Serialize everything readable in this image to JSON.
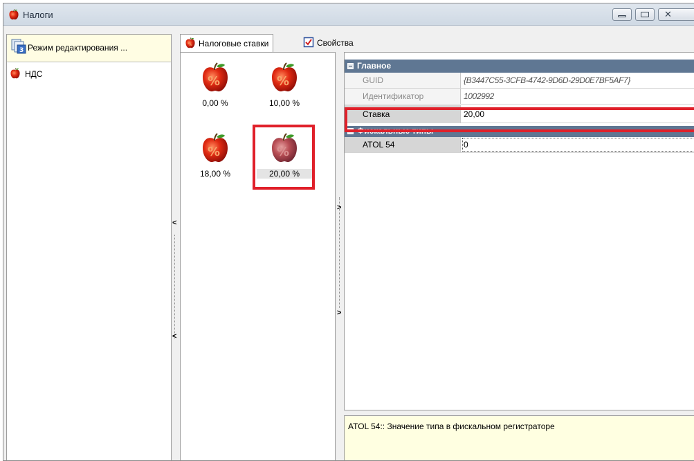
{
  "window": {
    "title": "Налоги",
    "controls": {
      "minimize": "minimize",
      "maximize": "maximize",
      "close": "close"
    }
  },
  "left_panel": {
    "mode_label": "Режим редактирования ...",
    "mode_icon": "edit-mode-icon",
    "tree": [
      {
        "label": "НДС",
        "icon": "apple-icon"
      }
    ]
  },
  "tabs": [
    {
      "label": "Налоговые ставки",
      "icon": "tax-apple-icon",
      "active": true
    },
    {
      "label": "Свойства",
      "icon": "checkbox-properties-icon",
      "active": false
    }
  ],
  "tax_rates": [
    {
      "label": "0,00 %",
      "selected": false
    },
    {
      "label": "10,00 %",
      "selected": false
    },
    {
      "label": "18,00 %",
      "selected": false
    },
    {
      "label": "20,00 %",
      "selected": true
    }
  ],
  "property_grid": {
    "categories": [
      {
        "title": "Главное",
        "rows": [
          {
            "name": "GUID",
            "value": "{B3447C55-3CFB-4742-9D6D-29D0E7BF5AF7}",
            "readonly": true
          },
          {
            "name": "Идентификатор",
            "value": "1002992",
            "readonly": true
          },
          {
            "name": "Ставка",
            "value": "20,00",
            "readonly": false
          }
        ]
      },
      {
        "title": "Фискальные типы",
        "rows": [
          {
            "name": "ATOL 54",
            "value": "0",
            "readonly": false
          }
        ]
      }
    ],
    "description": "ATOL 54:: Значение типа в фискальном регистраторе"
  },
  "colors": {
    "highlight": "#e0202a",
    "category_header": "#5f7793",
    "description_bg": "#ffffe1",
    "mode_header_bg": "#fffde3"
  }
}
